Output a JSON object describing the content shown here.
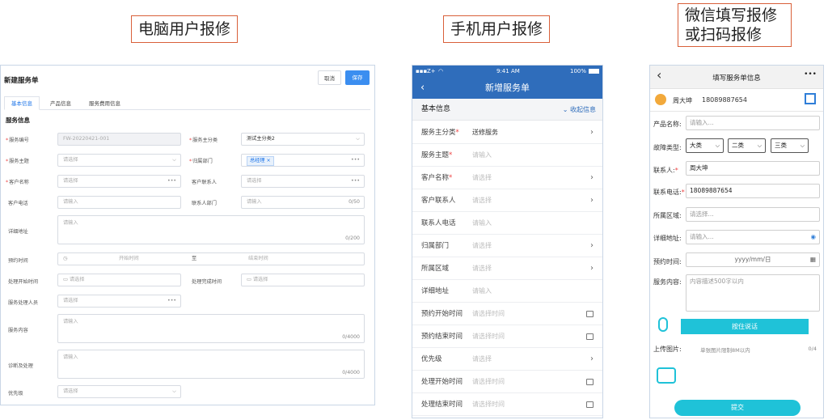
{
  "captions": {
    "pc": "电脑用户报修",
    "mobile": "手机用户报修",
    "wechat_line1": "微信填写报修",
    "wechat_line2": "或扫码报修"
  },
  "pc": {
    "title": "新建服务单",
    "cancel": "取消",
    "save": "保存",
    "tabs": [
      "基本信息",
      "产品信息",
      "服务费用信息"
    ],
    "section": "服务信息",
    "fields": {
      "service_no_label": "服务编号",
      "service_no_value": "FW-20220421-001",
      "main_cat_label": "服务主分类",
      "main_cat_value": "测试主分类2",
      "subject_label": "服务主题",
      "subject_ph": "请选择",
      "dept_label": "归属部门",
      "dept_tag": "总经理",
      "customer_label": "客户名称",
      "customer_ph": "请选择",
      "contact_label": "客户联系人",
      "contact_ph": "请选择",
      "phone_label": "客户电话",
      "phone_ph": "请输入",
      "contact_dept_label": "联系人部门",
      "contact_dept_ph": "请输入",
      "contact_dept_count": "0/50",
      "address_label": "详细地址",
      "address_ph": "请输入",
      "address_count": "0/200",
      "appt_label": "预约时间",
      "appt_start": "开始时间",
      "appt_to": "至",
      "appt_end": "结束时间",
      "proc_start_label": "处理开始时间",
      "proc_start_ph": "请选择",
      "proc_end_label": "处理完成时间",
      "proc_end_ph": "请选择",
      "handler_label": "服务处理人员",
      "handler_ph": "请选择",
      "content_label": "服务内容",
      "content_ph": "请输入",
      "content_count": "0/4000",
      "diag_label": "诊断及处理",
      "diag_ph": "请输入",
      "diag_count": "0/4000",
      "priority_label": "优先级",
      "priority_ph": "请选择"
    }
  },
  "mobile": {
    "status_carrier": "Z+",
    "status_time": "9:41 AM",
    "status_battery": "100%",
    "nav_title": "新增服务单",
    "section_title": "基本信息",
    "collapse": "收起信息",
    "rows": [
      {
        "label": "服务主分类",
        "req": "*",
        "value": "送修服务",
        "arrow": "›"
      },
      {
        "label": "服务主题",
        "req": "*",
        "value": "请输入",
        "arrow": ""
      },
      {
        "label": "客户名称",
        "req": "*",
        "value": "请选择",
        "arrow": "›"
      },
      {
        "label": "客户联系人",
        "req": "",
        "value": "请选择",
        "arrow": "›"
      },
      {
        "label": "联系人电话",
        "req": "",
        "value": "请输入",
        "arrow": ""
      },
      {
        "label": "归属部门",
        "req": "",
        "value": "请选择",
        "arrow": "›"
      },
      {
        "label": "所属区域",
        "req": "",
        "value": "请选择",
        "arrow": "›"
      },
      {
        "label": "详细地址",
        "req": "",
        "value": "请输入",
        "arrow": ""
      },
      {
        "label": "预约开始时间",
        "req": "",
        "value": "请选择时间",
        "arrow": ""
      },
      {
        "label": "预约结束时间",
        "req": "",
        "value": "请选择时间",
        "arrow": ""
      },
      {
        "label": "优先级",
        "req": "",
        "value": "请选择",
        "arrow": "›"
      },
      {
        "label": "处理开始时间",
        "req": "",
        "value": "请选择时间",
        "arrow": ""
      },
      {
        "label": "处理结束时间",
        "req": "",
        "value": "请选择时间",
        "arrow": ""
      }
    ]
  },
  "wechat": {
    "back": "‹",
    "title": "填写服务单信息",
    "more": "•••",
    "user_name": "周大坤",
    "user_phone": "18089887654",
    "product_label": "产品名称:",
    "product_ph": "请输入...",
    "fault_label": "故障类型:",
    "fault_sel1": "大类",
    "fault_sel2": "二类",
    "fault_sel3": "三类",
    "contact_label": "联系人:",
    "contact_value": "周大坤",
    "phone_label": "联系电话:",
    "phone_value": "18089887654",
    "region_label": "所属区域:",
    "region_ph": "请选择...",
    "address_label": "详细地址:",
    "address_ph": "请输入...",
    "appt_label": "预约时间:",
    "appt_ph": "yyyy/mm/日",
    "content_label": "服务内容:",
    "content_ph": "内容描述500字以内",
    "voice_btn": "按住说话",
    "upload_label": "上传图片:",
    "upload_hint": "单张图片限制8M以内",
    "upload_count": "0/4",
    "submit": "提交"
  }
}
